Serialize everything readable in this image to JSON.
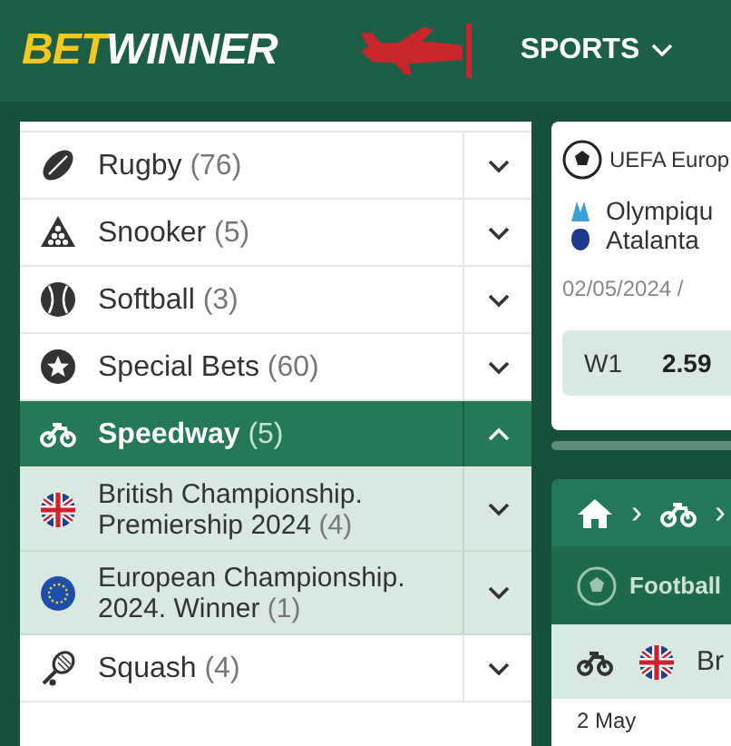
{
  "header": {
    "logo_bet": "BET",
    "logo_winner": "WINNER",
    "nav": "SPORTS"
  },
  "sports": [
    {
      "kind": "sport",
      "name": "Rugby",
      "count": "(76)",
      "selected": false,
      "expanded": false
    },
    {
      "kind": "sport",
      "name": "Snooker",
      "count": "(5)",
      "selected": false,
      "expanded": false
    },
    {
      "kind": "sport",
      "name": "Softball",
      "count": "(3)",
      "selected": false,
      "expanded": false
    },
    {
      "kind": "sport",
      "name": "Special Bets",
      "count": "(60)",
      "selected": false,
      "expanded": false
    },
    {
      "kind": "sport",
      "name": "Speedway",
      "count": "(5)",
      "selected": true,
      "expanded": true,
      "children": [
        {
          "kind": "league",
          "name": "British Championship. Premiership 2024",
          "count": "(4)",
          "expanded": false
        },
        {
          "kind": "league",
          "name": "European Championship. 2024. Winner",
          "count": "(1)",
          "expanded": false
        }
      ]
    },
    {
      "kind": "sport",
      "name": "Squash",
      "count": "(4)",
      "selected": false,
      "expanded": false
    }
  ],
  "match_card": {
    "league": "UEFA Europ",
    "teams": [
      "Olympiqu",
      "Atalanta"
    ],
    "datetime": "02/05/2024 /",
    "odds": [
      {
        "label": "W1",
        "value": "2.59"
      }
    ]
  },
  "event_panel": {
    "breadcrumb": [
      "›",
      "›"
    ],
    "sport": "Football",
    "row_text": "Br",
    "date": "2 May"
  }
}
